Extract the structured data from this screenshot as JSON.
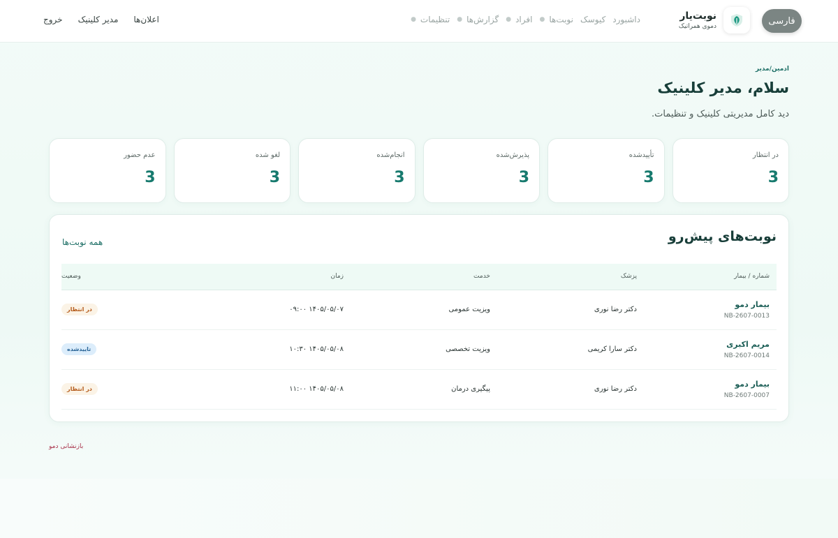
{
  "header": {
    "language_label": "فارسی",
    "brand_name": "نوبت‌یار",
    "brand_subtitle": "دموی همراتیک",
    "nav": [
      {
        "label": "داشبورد",
        "dot": false
      },
      {
        "label": "کیوسک",
        "dot": false
      },
      {
        "label": "نوبت‌ها",
        "dot": true
      },
      {
        "label": "افراد",
        "dot": true
      },
      {
        "label": "گزارش‌ها",
        "dot": true
      },
      {
        "label": "تنظیمات",
        "dot": true
      }
    ],
    "user_links": {
      "announcements": "اعلان‌ها",
      "clinic_manager": "مدیر کلینیک",
      "logout": "خروج"
    }
  },
  "page": {
    "role": "ادمین/مدیر",
    "greeting": "سلام، مدیر کلینیک",
    "description": "دید کامل مدیریتی کلینیک و تنظیمات."
  },
  "stats": [
    {
      "label": "در انتظار",
      "value": "3"
    },
    {
      "label": "تأییدشده",
      "value": "3"
    },
    {
      "label": "پذیرش‌شده",
      "value": "3"
    },
    {
      "label": "انجام‌شده",
      "value": "3"
    },
    {
      "label": "لغو شده",
      "value": "3"
    },
    {
      "label": "عدم حضور",
      "value": "3"
    }
  ],
  "upcoming": {
    "title": "نوبت‌های پیش‌رو",
    "all_link": "همه نوبت‌ها",
    "columns": {
      "patient": "شماره / بیمار",
      "doctor": "پزشک",
      "service": "خدمت",
      "time": "زمان",
      "status": "وضعیت"
    },
    "rows": [
      {
        "patient": "بیمار دمو",
        "code": "NB-2607-0013",
        "doctor": "دکتر رضا نوری",
        "service": "ویزیت عمومی",
        "time": "۱۴۰۵/۰۵/۰۷ ۰۹:۰۰",
        "status": "در انتظار",
        "status_type": "pending"
      },
      {
        "patient": "مریم اکبری",
        "code": "NB-2607-0014",
        "doctor": "دکتر سارا کریمی",
        "service": "ویزیت تخصصی",
        "time": "۱۴۰۵/۰۵/۰۸ ۱۰:۳۰",
        "status": "تاییدشده",
        "status_type": "confirmed"
      },
      {
        "patient": "بیمار دمو",
        "code": "NB-2607-0007",
        "doctor": "دکتر رضا نوری",
        "service": "پیگیری درمان",
        "time": "۱۴۰۵/۰۵/۰۸ ۱۱:۰۰",
        "status": "در انتظار",
        "status_type": "pending"
      }
    ]
  },
  "footer": {
    "reset_demo": "بازنشانی دمو"
  },
  "colors": {
    "accent": "#177a6e",
    "pending_badge": "#fbf3e6",
    "confirmed_badge": "#dcedfb"
  }
}
